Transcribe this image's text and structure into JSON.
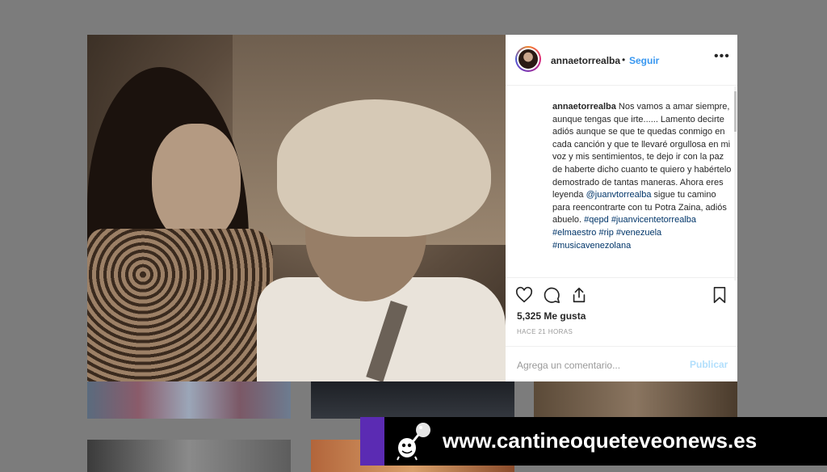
{
  "post": {
    "username": "annaetorrealba",
    "separator": "•",
    "follow_label": "Seguir",
    "more_label": "•••",
    "caption": {
      "username": "annaetorrealba",
      "text_1": " Nos vamos a amar siempre, aunque tengas que irte...... Lamento decirte adiós aunque se que te quedas conmigo en cada canción y que te llevaré orgullosa en mi voz y mis sentimientos, te dejo ir con la paz de haberte dicho cuanto te quiero y habértelo demostrado de tantas maneras. Ahora eres leyenda ",
      "mention": "@juanvtorrealba",
      "text_2": " sigue tu camino para reencontrarte con tu Potra Zaina, adiós abuelo. ",
      "hashtags": [
        "#qepd",
        "#juanvicentetorrealba",
        "#elmaestro",
        "#rip",
        "#venezuela",
        "#musicavenezolana"
      ]
    },
    "likes": "5,325 Me gusta",
    "time": "HACE 21 HORAS",
    "comment_placeholder": "Agrega un comentario...",
    "publish_label": "Publicar"
  },
  "icons": {
    "like": "heart-icon",
    "comment": "comment-icon",
    "share": "share-icon",
    "save": "bookmark-icon"
  },
  "banner": {
    "url": "www.cantineoqueteveonews.es"
  },
  "colors": {
    "link_blue": "#3897f0",
    "text": "#262626",
    "muted": "#999999",
    "publish_disabled": "#b2dffc",
    "banner_accent": "#5b2bb3"
  }
}
